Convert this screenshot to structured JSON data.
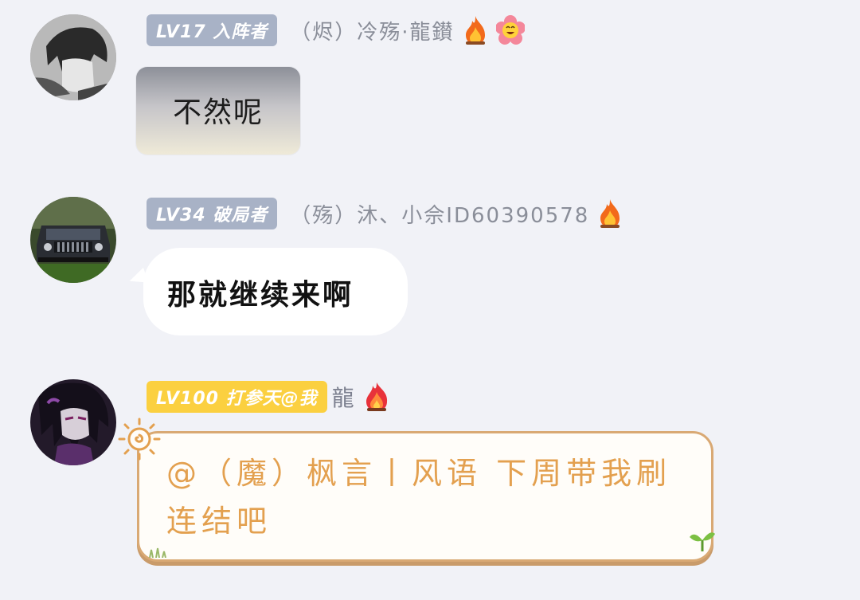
{
  "messages": [
    {
      "avatar": "user-avatar-grayscale-anime",
      "badge": "LV17 入阵者",
      "badge_color": "#a8b2c6",
      "nickname": "（烬）冷殇·龍鑚",
      "icons": [
        "fire-icon",
        "smiling-flower-icon"
      ],
      "text": "不然呢"
    },
    {
      "avatar": "user-avatar-jeep",
      "badge": "LV34 破局者",
      "badge_color": "#a8b2c6",
      "nickname": "（殇）沐、小佘ID60390578",
      "icons": [
        "fire-icon"
      ],
      "text": "那就继续来啊"
    },
    {
      "avatar": "user-avatar-anime-dark",
      "badge": "LV100 打参天@我",
      "badge_color": "#fbd040",
      "nickname": "龍",
      "icons": [
        "red-fire-icon"
      ],
      "text": "@（魔）枫言丨风语 下周带我刷连结吧"
    }
  ]
}
